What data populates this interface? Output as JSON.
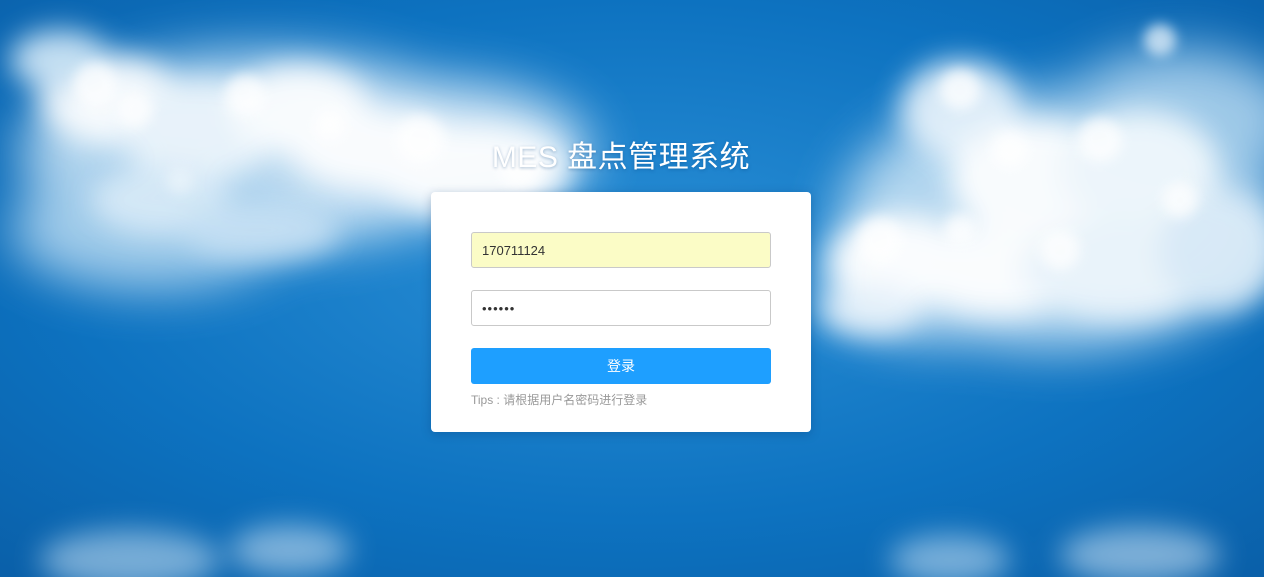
{
  "page": {
    "title": "MES 盘点管理系统",
    "colors": {
      "background": "#0d6fbd",
      "card": "#ffffff",
      "button": "#1e9fff",
      "autofill": "#fbfcc6"
    }
  },
  "login": {
    "username_value": "170711124",
    "password_value": "123456",
    "submit_label": "登录",
    "tips": "Tips : 请根据用户名密码进行登录"
  }
}
